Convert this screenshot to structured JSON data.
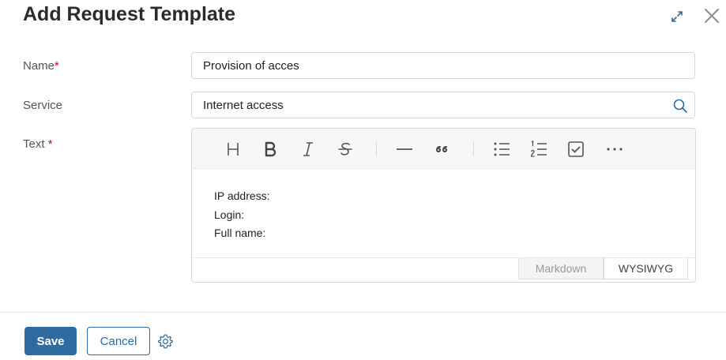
{
  "dialog": {
    "title": "Add Request Template"
  },
  "form": {
    "name": {
      "label": "Name",
      "required_mark": "*",
      "value": "Provision of acces"
    },
    "service": {
      "label": "Service",
      "value": "Internet access"
    },
    "text": {
      "label": "Text",
      "required_mark": "*",
      "lines": [
        "IP address:",
        "Login:",
        "Full name:"
      ]
    }
  },
  "editor": {
    "toolbar": [
      "heading-icon",
      "bold-icon",
      "italic-icon",
      "strikethrough-icon",
      "horizontal-rule-icon",
      "quote-icon",
      "bullet-list-icon",
      "numbered-list-icon",
      "checkbox-icon",
      "more-icon"
    ],
    "tabs": {
      "markdown": "Markdown",
      "wysiwyg": "WYSIWYG",
      "active": "WYSIWYG"
    }
  },
  "footer": {
    "save_label": "Save",
    "cancel_label": "Cancel"
  },
  "colors": {
    "primary": "#2f6aa1",
    "required": "#d0021b"
  }
}
